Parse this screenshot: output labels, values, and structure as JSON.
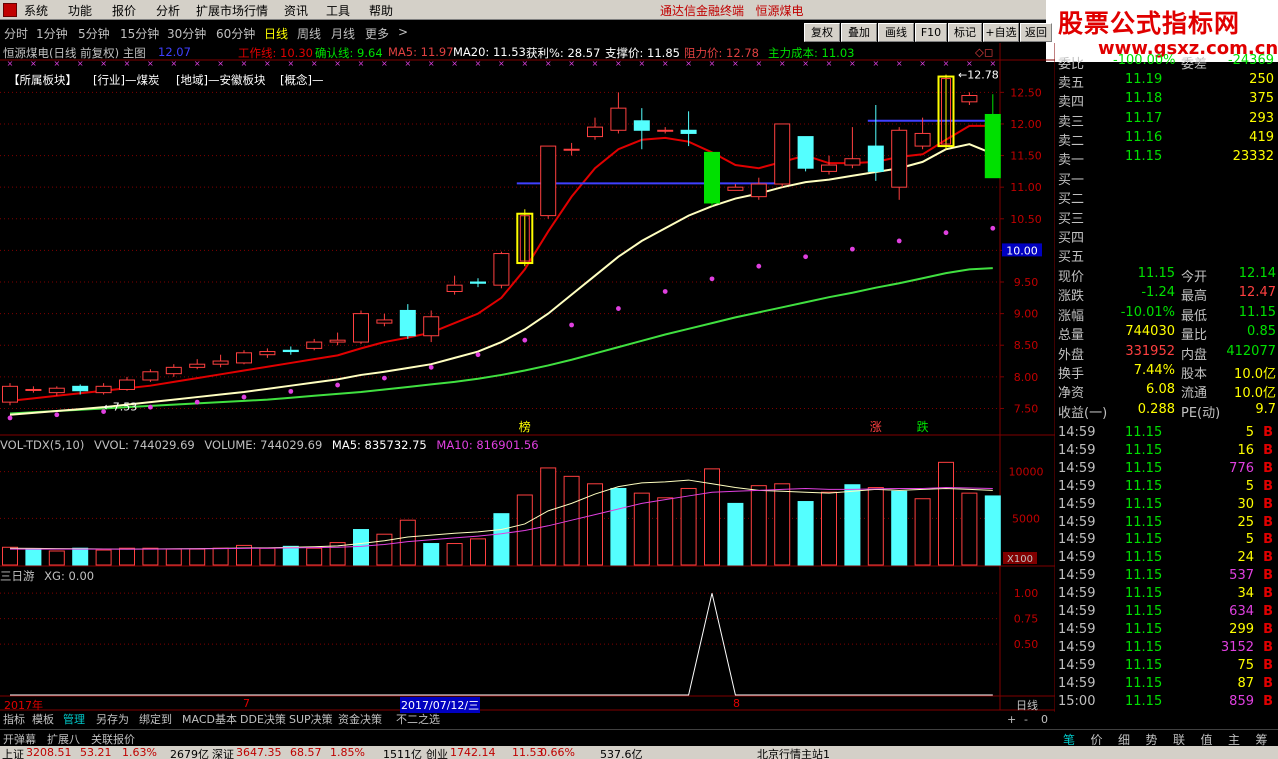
{
  "menubar": {
    "items": [
      "系统",
      "功能",
      "报价",
      "分析",
      "扩展市场行情",
      "资讯",
      "工具",
      "帮助"
    ],
    "title": "通达信金融终端",
    "stock": "恒源煤电"
  },
  "watermark": {
    "line1": "股票公式指标网",
    "line2": "www.gsxz.com.cn"
  },
  "toolbar": {
    "periods": [
      "分时",
      "1分钟",
      "5分钟",
      "15分钟",
      "30分钟",
      "60分钟",
      "日线",
      "周线",
      "月线",
      "更多"
    ],
    "active_period": "日线",
    "more_arrow": ">",
    "buttons": [
      "复权",
      "叠加",
      "画线",
      "F10",
      "标记",
      "+自选",
      "返回"
    ]
  },
  "info": {
    "title": "恒源煤电(日线 前复权) 主图",
    "price": "12.07",
    "work_line": "工作线: 10.30",
    "confirm_line": "确认线: 9.64",
    "ma5": "MA5: 11.97",
    "ma20": "MA20: 11.53",
    "profit": "获利%: 28.57",
    "support": "支撑价: 11.85",
    "resist": "阻力价: 12.78",
    "cost": "主力成本: 11.03",
    "diamonds": "◇◻"
  },
  "sectors": [
    "【所属板块】",
    "[行业]—煤炭",
    "[地域]—安徽板块",
    "[概念]—"
  ],
  "volume_info": [
    "VOL-TDX(5,10)",
    "VVOL: 744029.69",
    "VOLUME: 744029.69",
    "MA5: 835732.75",
    "MA10: 816901.56"
  ],
  "xg_info": [
    "三日游",
    "XG: 0.00"
  ],
  "days": {
    "year": "2017年",
    "m7": "7",
    "date": "2017/07/12/三",
    "m8": "8",
    "unit": "日线"
  },
  "bottom_tabs": [
    "指标",
    "模板",
    "管理",
    "另存为",
    "绑定到",
    "MACD基本",
    "DDE决策",
    "SUP决策",
    "资金决策",
    "不二之选"
  ],
  "active_bottom_tab": "管理",
  "zoom": {
    "plus": "+",
    "minus": "-",
    "zero": "0"
  },
  "bottom2": [
    "开弹幕",
    "扩展八",
    "关联报价"
  ],
  "statusbar": [
    {
      "t": "上证",
      "c": "#000000"
    },
    {
      "t": "3208.51",
      "c": "#c00000"
    },
    {
      "t": "53.21",
      "c": "#c00000"
    },
    {
      "t": "1.63%",
      "c": "#c00000"
    },
    {
      "t": "2679亿",
      "c": "#000000"
    },
    {
      "t": "深证",
      "c": "#000000"
    },
    {
      "t": "3647.35",
      "c": "#c00000"
    },
    {
      "t": "68.57",
      "c": "#c00000"
    },
    {
      "t": "1.85%",
      "c": "#c00000"
    },
    {
      "t": "1511亿",
      "c": "#000000"
    },
    {
      "t": "创业",
      "c": "#000000"
    },
    {
      "t": "1742.14",
      "c": "#c00000"
    },
    {
      "t": "11.53",
      "c": "#c00000"
    },
    {
      "t": "0.66%",
      "c": "#c00000"
    },
    {
      "t": "537.6亿",
      "c": "#000000"
    },
    {
      "t": "北京行情主站1",
      "c": "#000000"
    }
  ],
  "orderbook": {
    "weibi": "委比",
    "weibi_val": "-100.00%",
    "weicha": "委差",
    "weicha_val": "-24369",
    "sells": [
      {
        "label": "卖五",
        "price": "11.19",
        "vol": "250"
      },
      {
        "label": "卖四",
        "price": "11.18",
        "vol": "375"
      },
      {
        "label": "卖三",
        "price": "11.17",
        "vol": "293"
      },
      {
        "label": "卖二",
        "price": "11.16",
        "vol": "419"
      },
      {
        "label": "卖一",
        "price": "11.15",
        "vol": "23332"
      }
    ],
    "buys": [
      "买一",
      "买二",
      "买三",
      "买四",
      "买五"
    ]
  },
  "quote": [
    {
      "l1": "现价",
      "v1": "11.15",
      "c1": "#00e000",
      "l2": "今开",
      "v2": "12.14",
      "c2": "#00e000"
    },
    {
      "l1": "涨跌",
      "v1": "-1.24",
      "c1": "#00e000",
      "l2": "最高",
      "v2": "12.47",
      "c2": "#ff4040"
    },
    {
      "l1": "涨幅",
      "v1": "-10.01%",
      "c1": "#00e000",
      "l2": "最低",
      "v2": "11.15",
      "c2": "#00e000"
    },
    {
      "l1": "总量",
      "v1": "744030",
      "c1": "#ffff00",
      "l2": "量比",
      "v2": "0.85",
      "c2": "#00e000"
    },
    {
      "l1": "外盘",
      "v1": "331952",
      "c1": "#ff4040",
      "l2": "内盘",
      "v2": "412077",
      "c2": "#00e000"
    },
    {
      "l1": "换手",
      "v1": "7.44%",
      "c1": "#ffff00",
      "l2": "股本",
      "v2": "10.0亿",
      "c2": "#ffff00"
    },
    {
      "l1": "净资",
      "v1": "6.08",
      "c1": "#ffff00",
      "l2": "流通",
      "v2": "10.0亿",
      "c2": "#ffff00"
    },
    {
      "l1": "收益(一)",
      "v1": "0.288",
      "c1": "#ffff00",
      "l2": "PE(动)",
      "v2": "9.7",
      "c2": "#ffff00"
    }
  ],
  "ticks": [
    {
      "t": "14:59",
      "p": "11.15",
      "v": "5",
      "c": "#ffff00",
      "b": "B"
    },
    {
      "t": "14:59",
      "p": "11.15",
      "v": "16",
      "c": "#ffff00",
      "b": "B"
    },
    {
      "t": "14:59",
      "p": "11.15",
      "v": "776",
      "c": "#e040e0",
      "b": "B"
    },
    {
      "t": "14:59",
      "p": "11.15",
      "v": "5",
      "c": "#ffff00",
      "b": "B"
    },
    {
      "t": "14:59",
      "p": "11.15",
      "v": "30",
      "c": "#ffff00",
      "b": "B"
    },
    {
      "t": "14:59",
      "p": "11.15",
      "v": "25",
      "c": "#ffff00",
      "b": "B"
    },
    {
      "t": "14:59",
      "p": "11.15",
      "v": "5",
      "c": "#ffff00",
      "b": "B"
    },
    {
      "t": "14:59",
      "p": "11.15",
      "v": "24",
      "c": "#ffff00",
      "b": "B"
    },
    {
      "t": "14:59",
      "p": "11.15",
      "v": "537",
      "c": "#e040e0",
      "b": "B"
    },
    {
      "t": "14:59",
      "p": "11.15",
      "v": "34",
      "c": "#ffff00",
      "b": "B"
    },
    {
      "t": "14:59",
      "p": "11.15",
      "v": "634",
      "c": "#e040e0",
      "b": "B"
    },
    {
      "t": "14:59",
      "p": "11.15",
      "v": "299",
      "c": "#ffff00",
      "b": "B"
    },
    {
      "t": "14:59",
      "p": "11.15",
      "v": "3152",
      "c": "#e040e0",
      "b": "B"
    },
    {
      "t": "14:59",
      "p": "11.15",
      "v": "75",
      "c": "#ffff00",
      "b": "B"
    },
    {
      "t": "14:59",
      "p": "11.15",
      "v": "87",
      "c": "#ffff00",
      "b": "B"
    },
    {
      "t": "15:00",
      "p": "11.15",
      "v": "859",
      "c": "#e040e0",
      "b": "B"
    }
  ],
  "right_tabs": [
    "笔",
    "价",
    "细",
    "势",
    "联",
    "值",
    "主",
    "筹"
  ],
  "active_right_tab": "笔",
  "chart_data": {
    "type": "candlestick",
    "price_axis": {
      "ticks": [
        "12.50",
        "12.00",
        "11.50",
        "11.00",
        "10.50",
        "10.00",
        "9.50",
        "9.00",
        "8.50",
        "8.00",
        "7.50"
      ],
      "ylim": [
        7.08,
        12.98
      ]
    },
    "current_price_label": "10.00",
    "high_label": "12.78",
    "low_label": "7.53",
    "low_arrow": "←",
    "high_arrow": "←",
    "candles": [
      [
        7.6,
        7.85,
        7.55,
        7.9
      ],
      [
        7.8,
        7.8,
        7.75,
        7.85
      ],
      [
        7.75,
        7.82,
        7.7,
        7.85
      ],
      [
        7.85,
        7.78,
        7.72,
        7.88
      ],
      [
        7.75,
        7.85,
        7.72,
        7.9
      ],
      [
        7.8,
        7.95,
        7.78,
        8.0
      ],
      [
        7.95,
        8.08,
        7.92,
        8.12
      ],
      [
        8.05,
        8.15,
        8.0,
        8.2
      ],
      [
        8.15,
        8.2,
        8.12,
        8.28
      ],
      [
        8.2,
        8.25,
        8.15,
        8.35
      ],
      [
        8.22,
        8.38,
        8.2,
        8.42
      ],
      [
        8.35,
        8.4,
        8.3,
        8.45
      ],
      [
        8.42,
        8.4,
        8.35,
        8.48
      ],
      [
        8.45,
        8.55,
        8.42,
        8.6
      ],
      [
        8.55,
        8.58,
        8.5,
        8.7
      ],
      [
        8.55,
        9.0,
        8.52,
        9.05
      ],
      [
        8.85,
        8.9,
        8.8,
        9.0
      ],
      [
        9.05,
        8.65,
        8.6,
        9.15
      ],
      [
        8.65,
        8.95,
        8.55,
        9.05
      ],
      [
        9.35,
        9.45,
        9.3,
        9.6
      ],
      [
        9.5,
        9.48,
        9.42,
        9.56
      ],
      [
        9.45,
        9.95,
        9.4,
        9.98
      ],
      [
        9.8,
        10.58,
        9.75,
        10.65
      ],
      [
        10.55,
        11.65,
        10.5,
        11.65
      ],
      [
        11.6,
        11.6,
        11.5,
        11.7
      ],
      [
        11.8,
        11.95,
        11.75,
        12.1
      ],
      [
        11.9,
        12.25,
        11.85,
        12.5
      ],
      [
        12.05,
        11.9,
        11.6,
        12.25
      ],
      [
        11.9,
        11.9,
        11.85,
        11.95
      ],
      [
        11.9,
        11.85,
        11.65,
        12.2
      ],
      [
        11.55,
        10.75,
        10.7,
        11.55
      ],
      [
        10.95,
        11.0,
        10.95,
        11.05
      ],
      [
        10.85,
        11.05,
        10.8,
        11.15
      ],
      [
        11.05,
        12.0,
        11.0,
        12.0
      ],
      [
        11.8,
        11.3,
        11.25,
        11.8
      ],
      [
        11.25,
        11.35,
        11.2,
        11.5
      ],
      [
        11.35,
        11.45,
        11.3,
        11.95
      ],
      [
        11.65,
        11.25,
        11.1,
        12.3
      ],
      [
        11.0,
        11.9,
        10.8,
        11.95
      ],
      [
        11.65,
        11.85,
        11.6,
        12.1
      ],
      [
        11.65,
        12.75,
        11.6,
        12.78
      ],
      [
        12.35,
        12.45,
        12.3,
        12.5
      ],
      [
        12.15,
        11.15,
        11.15,
        12.47
      ]
    ],
    "special_candles": {
      "yellow_box": [
        22,
        40
      ]
    },
    "ma5": [
      7.62,
      7.66,
      7.7,
      7.74,
      7.78,
      7.82,
      7.86,
      7.92,
      7.98,
      8.04,
      8.1,
      8.16,
      8.22,
      8.28,
      8.34,
      8.45,
      8.55,
      8.62,
      8.7,
      8.85,
      9.0,
      9.25,
      9.7,
      10.3,
      10.85,
      11.3,
      11.6,
      11.75,
      11.78,
      11.72,
      11.55,
      11.35,
      11.3,
      11.4,
      11.5,
      11.38,
      11.38,
      11.4,
      11.48,
      11.52,
      11.75,
      11.97,
      11.97
    ],
    "ma10": [
      7.4,
      7.43,
      7.46,
      7.49,
      7.52,
      7.56,
      7.6,
      7.64,
      7.68,
      7.72,
      7.76,
      7.81,
      7.86,
      7.91,
      7.96,
      8.03,
      8.08,
      8.14,
      8.2,
      8.3,
      8.4,
      8.55,
      8.75,
      9.0,
      9.3,
      9.6,
      9.9,
      10.15,
      10.35,
      10.55,
      10.7,
      10.82,
      10.9,
      11.0,
      11.08,
      11.12,
      11.18,
      11.24,
      11.3,
      11.4,
      11.6,
      11.68,
      11.53
    ],
    "ma_dots": [
      7.35,
      7.38,
      7.4,
      7.42,
      7.45,
      7.48,
      7.52,
      7.56,
      7.6,
      7.64,
      7.68,
      7.72,
      7.77,
      7.82,
      7.87,
      7.92,
      7.98,
      8.05,
      8.15,
      8.25,
      8.35,
      8.45,
      8.58,
      8.7,
      8.82,
      8.95,
      9.08,
      9.22,
      9.35,
      9.45,
      9.55,
      9.65,
      9.75,
      9.82,
      9.9,
      9.95,
      10.02,
      10.08,
      10.15,
      10.22,
      10.28,
      10.32,
      10.35
    ],
    "ma_green": [
      7.42,
      7.44,
      7.46,
      7.48,
      7.5,
      7.52,
      7.54,
      7.56,
      7.58,
      7.6,
      7.62,
      7.64,
      7.67,
      7.7,
      7.73,
      7.76,
      7.8,
      7.84,
      7.88,
      7.92,
      7.97,
      8.03,
      8.1,
      8.18,
      8.27,
      8.37,
      8.47,
      8.57,
      8.67,
      8.76,
      8.85,
      8.94,
      9.02,
      9.1,
      9.18,
      9.26,
      9.33,
      9.41,
      9.48,
      9.56,
      9.64,
      9.7,
      9.72
    ],
    "supp_line": {
      "y": 11.06,
      "from": 22,
      "to": 33
    },
    "resist_line": {
      "y": 12.05,
      "from": 37,
      "to": 42
    },
    "markers": [
      {
        "i": 22,
        "t": "榜",
        "c": "#ffff00"
      },
      {
        "i": 37,
        "t": "涨",
        "c": "#ff4040"
      },
      {
        "i": 39,
        "t": "跌",
        "c": "#00e000"
      }
    ],
    "volume": {
      "ticks": [
        "10000",
        "5000"
      ],
      "unit": "X100",
      "ylim": [
        0,
        12000
      ],
      "values": [
        1900,
        1700,
        1500,
        1800,
        1600,
        1800,
        1800,
        1700,
        1700,
        1800,
        2100,
        1800,
        2000,
        1800,
        2400,
        3800,
        3300,
        4800,
        2300,
        2300,
        2800,
        5500,
        7500,
        10400,
        9500,
        8700,
        8200,
        7700,
        7200,
        8200,
        10300,
        6600,
        8500,
        8700,
        6800,
        7800,
        8600,
        8300,
        7900,
        7100,
        11000,
        7700,
        7400
      ],
      "ma5": [
        1800,
        1780,
        1760,
        1740,
        1720,
        1700,
        1720,
        1740,
        1760,
        1780,
        1820,
        1840,
        1900,
        1950,
        2050,
        2300,
        2600,
        3000,
        3200,
        3400,
        3550,
        3800,
        4400,
        5800,
        6600,
        7600,
        8400,
        8800,
        8900,
        9100,
        8700,
        8300,
        8000,
        7900,
        7800,
        7700,
        7900,
        8100,
        8000,
        8100,
        8200,
        8100,
        8000
      ],
      "ma10": [
        1700,
        1700,
        1700,
        1700,
        1700,
        1700,
        1700,
        1720,
        1730,
        1750,
        1780,
        1800,
        1830,
        1860,
        1900,
        2000,
        2200,
        2500,
        2700,
        2900,
        3100,
        3350,
        3700,
        4200,
        4800,
        5400,
        6000,
        6600,
        7000,
        7400,
        7800,
        7900,
        8000,
        8100,
        8200,
        8100,
        8100,
        8150,
        8200,
        8200,
        8300,
        8250,
        8200
      ],
      "red_idx": [
        0,
        2,
        4,
        5,
        6,
        7,
        8,
        9,
        10,
        11,
        13,
        14,
        16,
        17,
        19,
        20,
        22,
        23,
        24,
        25,
        27,
        28,
        29,
        30,
        32,
        33,
        35,
        37,
        39,
        40,
        41
      ]
    },
    "xg": {
      "ticks": [
        "1.00",
        "0.75",
        "0.50"
      ],
      "ylim": [
        0,
        1.1
      ],
      "peak_index": 30
    }
  }
}
